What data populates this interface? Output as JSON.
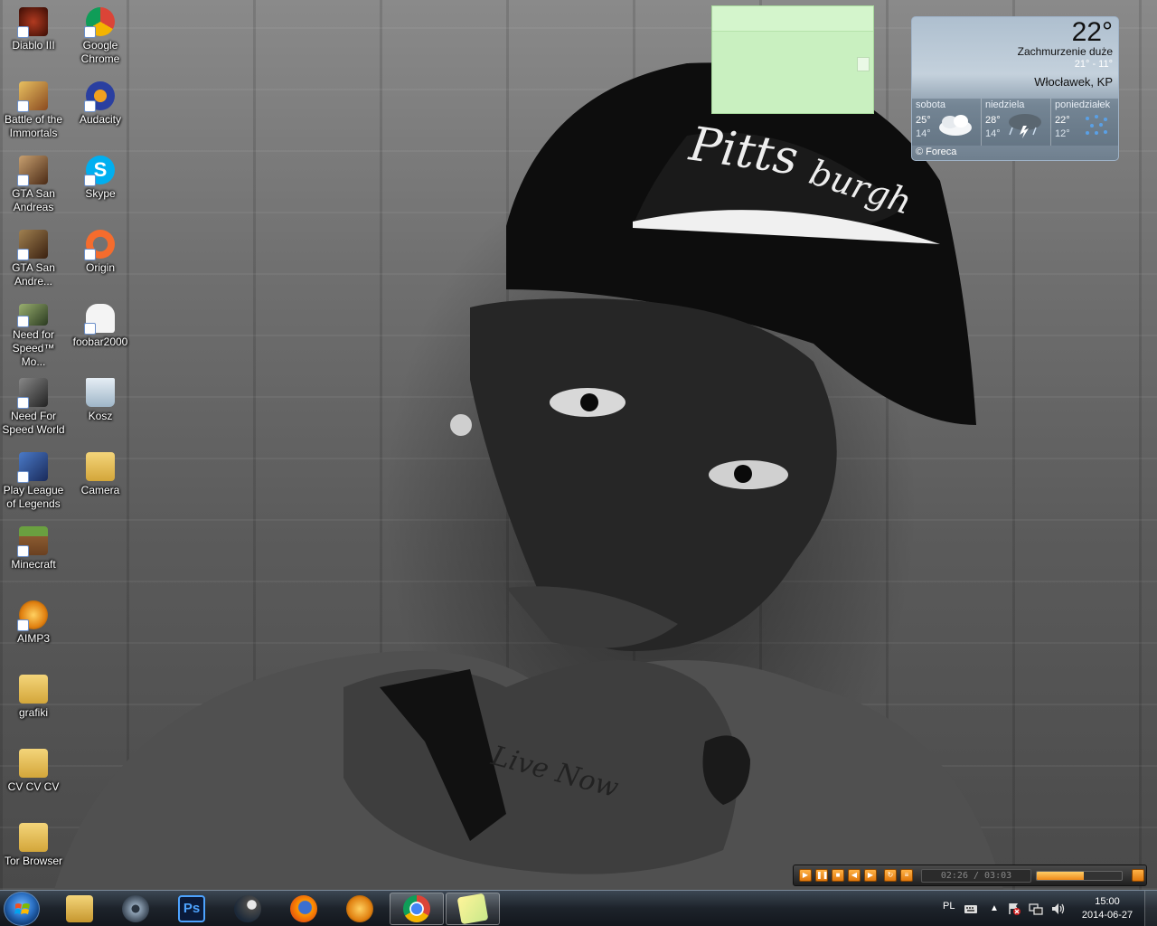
{
  "desktop": {
    "icons": [
      {
        "label": "Diablo III",
        "icon": "diablo-icon",
        "color": "#5a1f10"
      },
      {
        "label": "Battle of the Immortals",
        "icon": "game-icon",
        "color": "#c9a040"
      },
      {
        "label": "GTA San Andreas",
        "icon": "gta-icon",
        "color": "#8a5a3a"
      },
      {
        "label": "GTA San Andre...",
        "icon": "gta-icon",
        "color": "#6a4a2a"
      },
      {
        "label": "Need for Speed™ Mo...",
        "icon": "nfs-icon",
        "color": "#4a5a3a"
      },
      {
        "label": "Need For Speed World",
        "icon": "nfs-world-icon",
        "color": "#3a3a3a"
      },
      {
        "label": "Play League of Legends",
        "icon": "lol-icon",
        "color": "#2a4a8a"
      },
      {
        "label": "Minecraft",
        "icon": "minecraft-icon",
        "color": "#5a8a3a"
      },
      {
        "label": "AIMP3",
        "icon": "aimp-icon",
        "color": "#f0a020"
      },
      {
        "label": "grafiki",
        "icon": "folder-icon",
        "color": "#e8c25a"
      },
      {
        "label": "CV CV CV",
        "icon": "folder-icon",
        "color": "#e8c25a"
      },
      {
        "label": "Tor Browser",
        "icon": "folder-icon",
        "color": "#e8c25a"
      },
      {
        "label": "Google Chrome",
        "icon": "chrome-icon",
        "color": "#db4437"
      },
      {
        "label": "Audacity",
        "icon": "audacity-icon",
        "color": "#2a3fa0"
      },
      {
        "label": "Skype",
        "icon": "skype-icon",
        "color": "#00aff0"
      },
      {
        "label": "Origin",
        "icon": "origin-icon",
        "color": "#f56c2d"
      },
      {
        "label": "foobar2000",
        "icon": "foobar-icon",
        "color": "#ffffff"
      },
      {
        "label": "Kosz",
        "icon": "recycle-bin-icon",
        "color": "#9fb6c8"
      },
      {
        "label": "Camera",
        "icon": "folder-icon",
        "color": "#e8c25a"
      }
    ]
  },
  "weather": {
    "temperature": "22°",
    "condition": "Zachmurzenie duże",
    "range": "21° - 11°",
    "location": "Włocławek, KP",
    "credit": "© Foreca",
    "forecast": [
      {
        "day": "sobota",
        "high": "25°",
        "low": "14°",
        "icon": "cloudy-icon"
      },
      {
        "day": "niedziela",
        "high": "28°",
        "low": "14°",
        "icon": "storm-icon"
      },
      {
        "day": "poniedziałek",
        "high": "22°",
        "low": "12°",
        "icon": "rain-icon"
      }
    ]
  },
  "player": {
    "time": "02:26 / 03:03",
    "volume": 0.55,
    "accent": "#f08a1a"
  },
  "taskbar": {
    "apps": [
      {
        "name": "explorer",
        "icon": "folder-icon",
        "active": false
      },
      {
        "name": "app",
        "icon": "disc-icon",
        "active": false
      },
      {
        "name": "photoshop",
        "icon": "photoshop-icon",
        "active": false,
        "text": "Ps"
      },
      {
        "name": "steam",
        "icon": "steam-icon",
        "active": false
      },
      {
        "name": "firefox",
        "icon": "firefox-icon",
        "active": false
      },
      {
        "name": "aimp",
        "icon": "aimp-icon",
        "active": false
      },
      {
        "name": "chrome",
        "icon": "chrome-icon",
        "active": true
      },
      {
        "name": "sticky-notes",
        "icon": "sticky-notes-icon",
        "active": true
      }
    ],
    "tray": {
      "language": "PL",
      "time": "15:00",
      "date": "2014-06-27"
    }
  }
}
